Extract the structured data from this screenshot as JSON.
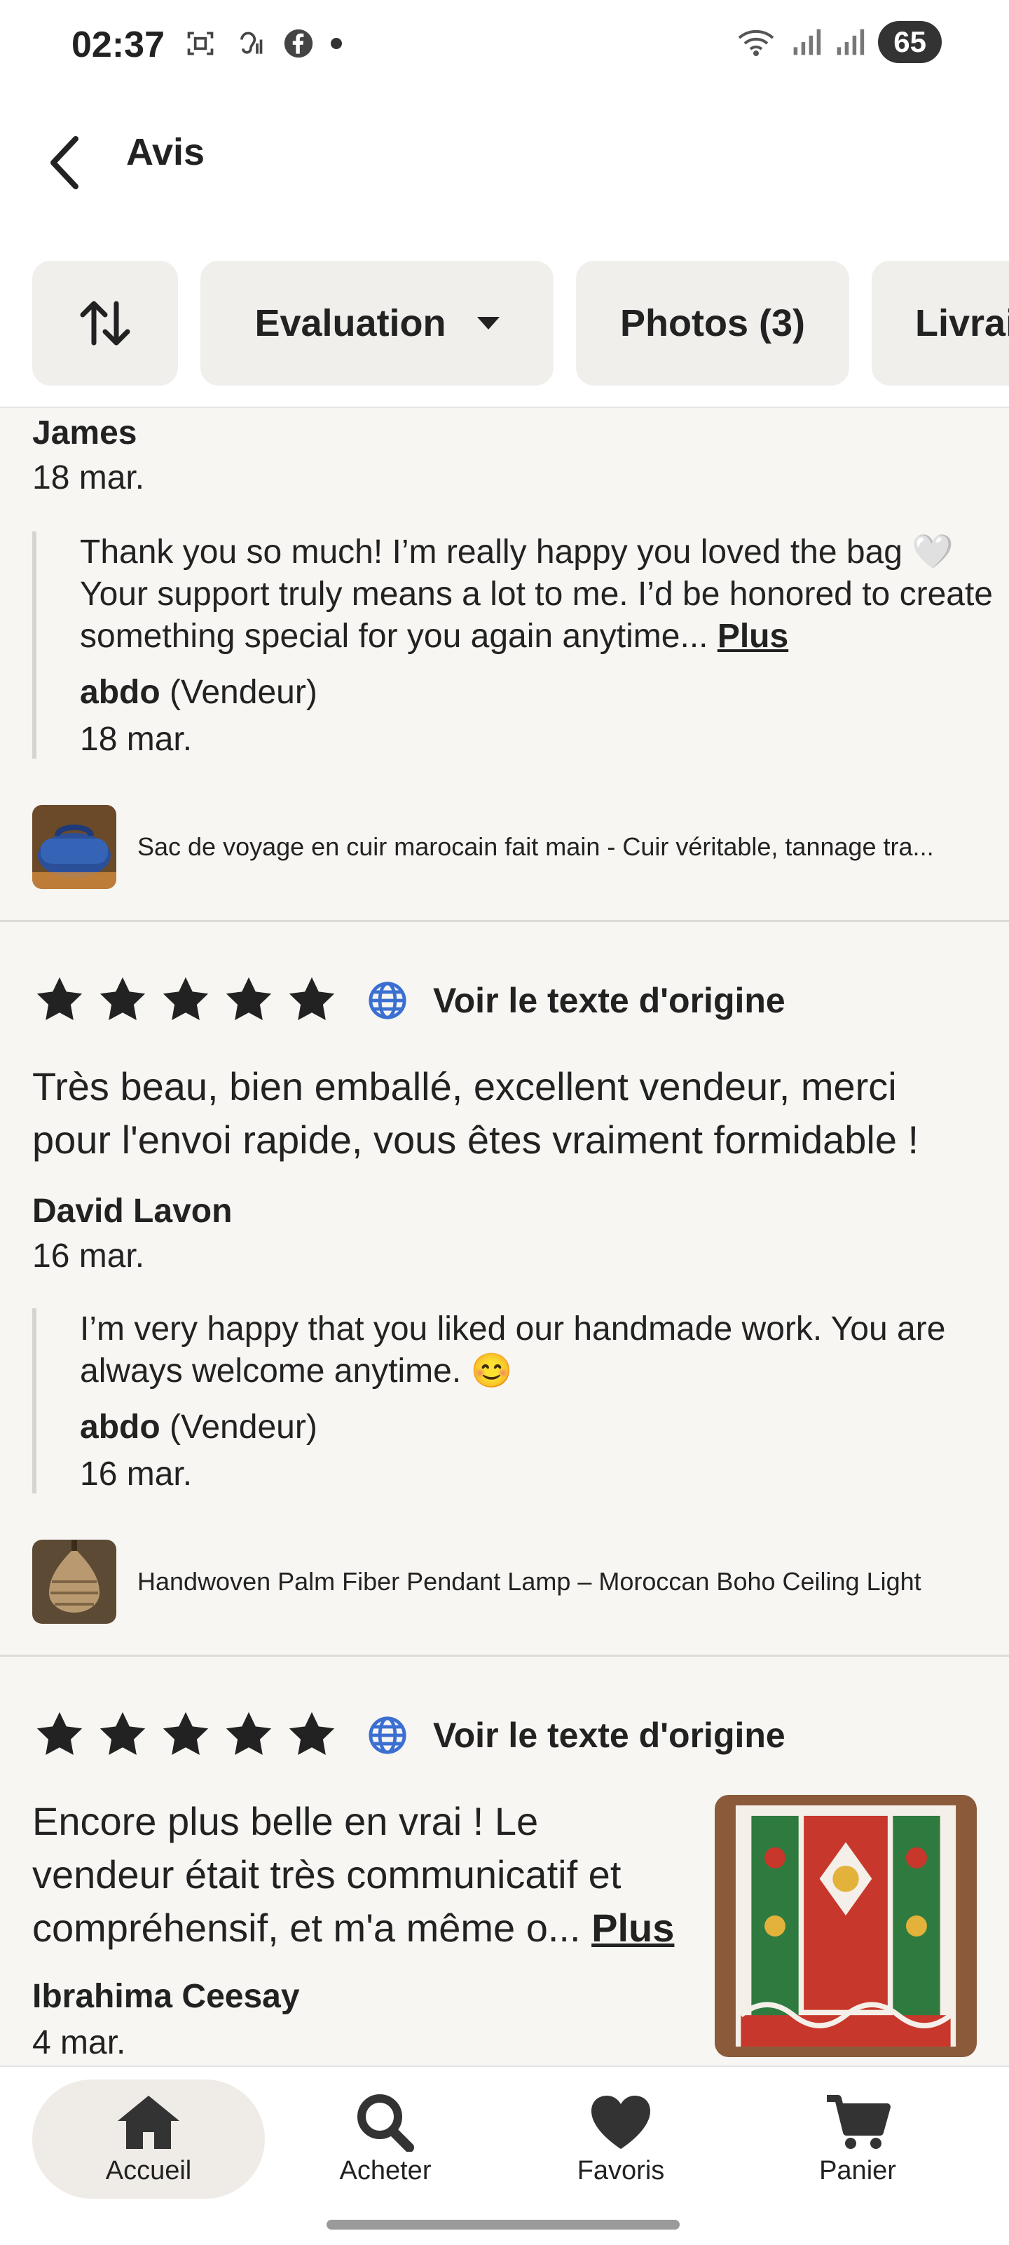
{
  "status_bar": {
    "time": "02:37",
    "battery": "65"
  },
  "header": {
    "title": "Avis"
  },
  "filters": {
    "evaluation": "Evaluation",
    "photos": "Photos (3)",
    "livraison": "Livrai"
  },
  "reviews": [
    {
      "author": "James",
      "date": "18 mar.",
      "reply": {
        "text": "Thank you so much! I’m really happy you loved the bag 🤍 Your support truly means a lot to me. I’d be honored to create something special for you again anytime...",
        "more": "Plus",
        "author": "abdo",
        "role": "(Vendeur)",
        "date": "18 mar."
      },
      "product": "Sac de voyage en cuir marocain fait main - Cuir véritable, tannage tra..."
    },
    {
      "rating": 5,
      "translate": "Voir le texte d'origine",
      "text": "Très beau, bien emballé, excellent vendeur, merci pour l'envoi rapide, vous êtes vraiment formidable !",
      "author": "David Lavon",
      "date": "16 mar.",
      "reply": {
        "text": "I’m very happy that you liked our handmade work. You are always welcome anytime. 😊",
        "author": "abdo",
        "role": "(Vendeur)",
        "date": "16 mar."
      },
      "product": "Handwoven Palm Fiber Pendant Lamp – Moroccan Boho Ceiling Light"
    },
    {
      "rating": 5,
      "translate": "Voir le texte d'origine",
      "text": "Encore plus belle en vrai ! Le vendeur était très communicatif et compréhensif, et m'a même o...",
      "more": "Plus",
      "author": "Ibrahima Ceesay",
      "date": "4 mar."
    }
  ],
  "nav": {
    "home": "Accueil",
    "shop": "Acheter",
    "favorites": "Favoris",
    "cart": "Panier"
  },
  "colors": {
    "accent_globe": "#3b6fd1",
    "background": "#f7f6f3",
    "chip": "#f0efec"
  }
}
